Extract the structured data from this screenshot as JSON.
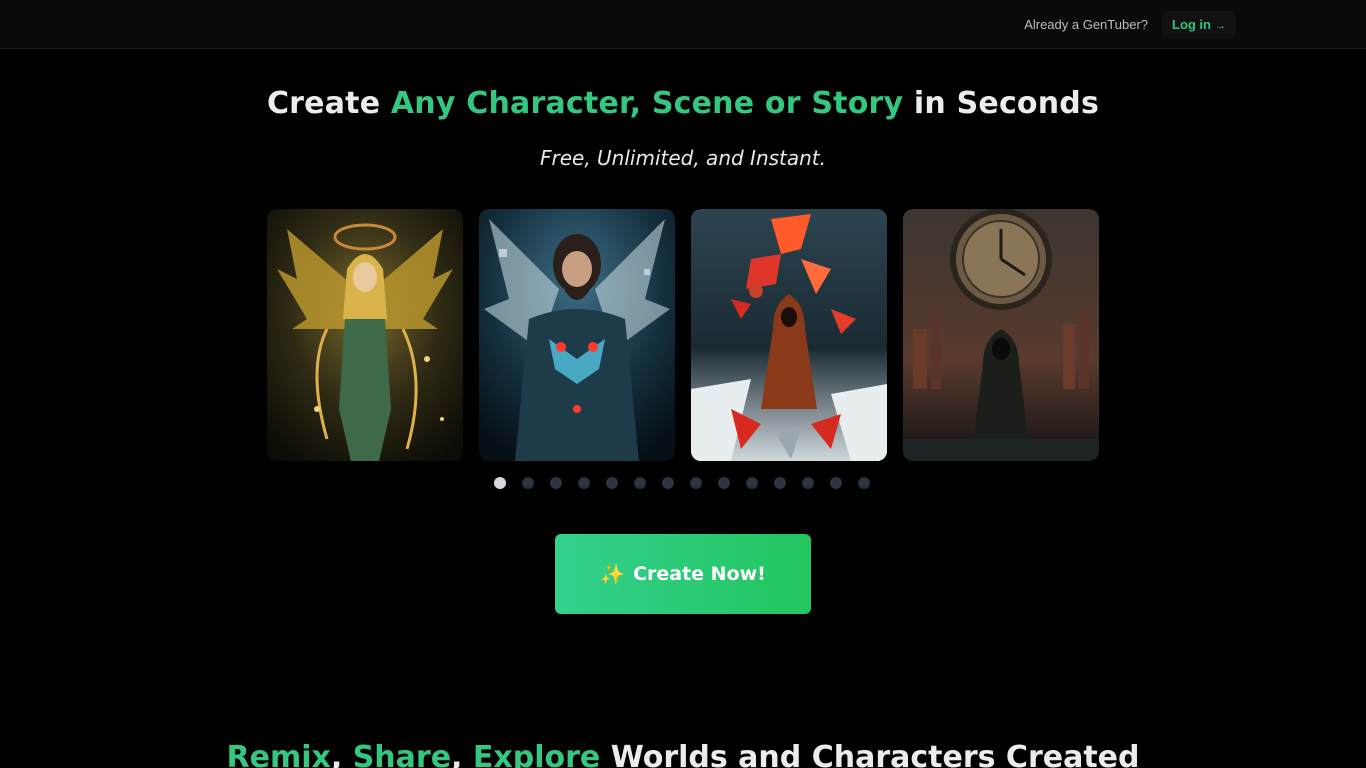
{
  "header": {
    "already_text": "Already a GenTuber?",
    "login_label": "Log in",
    "login_arrow": "→"
  },
  "hero": {
    "title_start": "Create ",
    "title_accent": "Any Character, Scene or Story",
    "title_end": " in Seconds",
    "subtitle": "Free, Unlimited, and Instant."
  },
  "carousel": {
    "slide_count": 14,
    "active_index": 0
  },
  "cta": {
    "icon": "sparkles-icon",
    "sparkle": "✨",
    "label": "Create Now!"
  },
  "section": {
    "accent1": "Remix",
    "sep1": ", ",
    "accent2": "Share",
    "sep2": ", ",
    "accent3": "Explore",
    "rest": " Worlds and Characters Created"
  },
  "colors": {
    "accent": "#34c77f",
    "background": "#000000",
    "cta_gradient_start": "#34d08f",
    "cta_gradient_end": "#22c55e"
  }
}
